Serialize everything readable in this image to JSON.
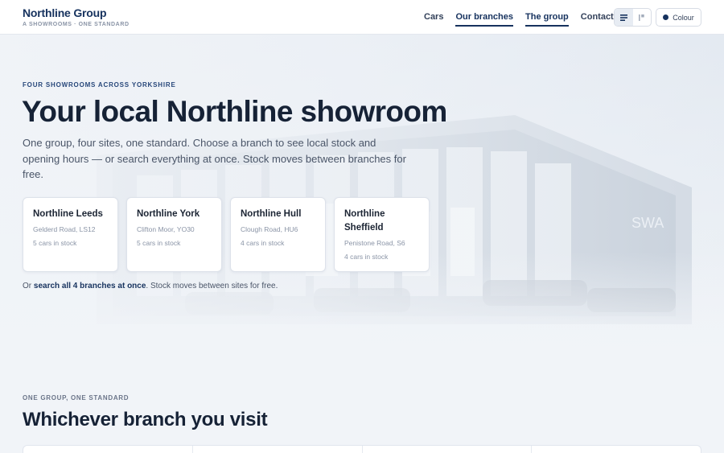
{
  "header": {
    "brand_name": "Northline Group",
    "brand_tagline": "A SHOWROOMS · ONE STANDARD",
    "nav": [
      {
        "label": "Cars",
        "active": false
      },
      {
        "label": "Our branches",
        "active": true
      },
      {
        "label": "The group",
        "active": true
      },
      {
        "label": "Contact",
        "active": false
      }
    ],
    "view_toggle": {
      "icons": [
        "list-view-icon",
        "grid-view-icon"
      ],
      "selected": "list-view-icon"
    },
    "colour_button_label": "Colour",
    "colour_dot_color": "#16325e"
  },
  "hero": {
    "eyebrow": "FOUR SHOWROOMS ACROSS YORKSHIRE",
    "title": "Your local Northline showroom",
    "intro": "One group, four sites, one standard. Choose a branch to see local stock and opening hours — or search everything at once. Stock moves between branches for free.",
    "background_sign": "SWA",
    "branches": [
      {
        "name": "Northline Leeds",
        "address": "Gelderd Road, LS12",
        "stock": "5 cars in stock"
      },
      {
        "name": "Northline York",
        "address": "Clifton Moor, YO30",
        "stock": "5 cars in stock"
      },
      {
        "name": "Northline Hull",
        "address": "Clough Road, HU6",
        "stock": "4 cars in stock"
      },
      {
        "name": "Northline Sheffield",
        "address": "Penistone Road, S6",
        "stock": "4 cars in stock"
      }
    ],
    "search_note_prefix": "Or ",
    "search_note_link": "search all 4 branches at once",
    "search_note_suffix": ". Stock moves between sites for free."
  },
  "section": {
    "eyebrow": "ONE GROUP, ONE STANDARD",
    "title": "Whichever branch you visit"
  },
  "colors": {
    "brand_navy": "#16325e",
    "page_bg": "#f1f4f8",
    "card_bg": "#ffffff"
  }
}
